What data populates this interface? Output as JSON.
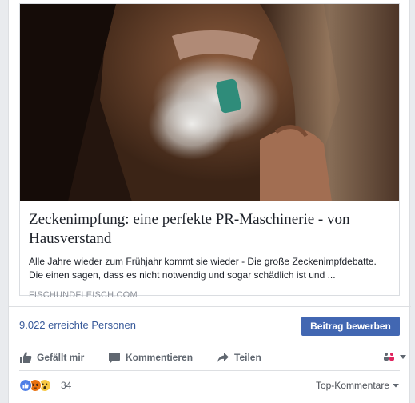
{
  "link": {
    "title": "Zeckenimpfung: eine perfekte PR-Maschinerie - von Hausverstand",
    "description": "Alle Jahre wieder zum Frühjahr kommt sie wieder - Die große Zeckenimpfdebatte. Die einen sagen, dass es nicht notwendig und sogar schädlich ist und ...",
    "domain": "FISCHUNDFLEISCH.COM"
  },
  "insights": {
    "reach": "9.022 erreichte Personen",
    "boost_label": "Beitrag bewerben"
  },
  "actions": {
    "like": "Gefällt mir",
    "comment": "Kommentieren",
    "share": "Teilen"
  },
  "reactions": {
    "count": "34",
    "types": [
      "like",
      "angry",
      "wow"
    ],
    "sort_label": "Top-Kommentare"
  },
  "colors": {
    "link": "#365899",
    "button": "#4267b2",
    "action_text": "#606770"
  }
}
